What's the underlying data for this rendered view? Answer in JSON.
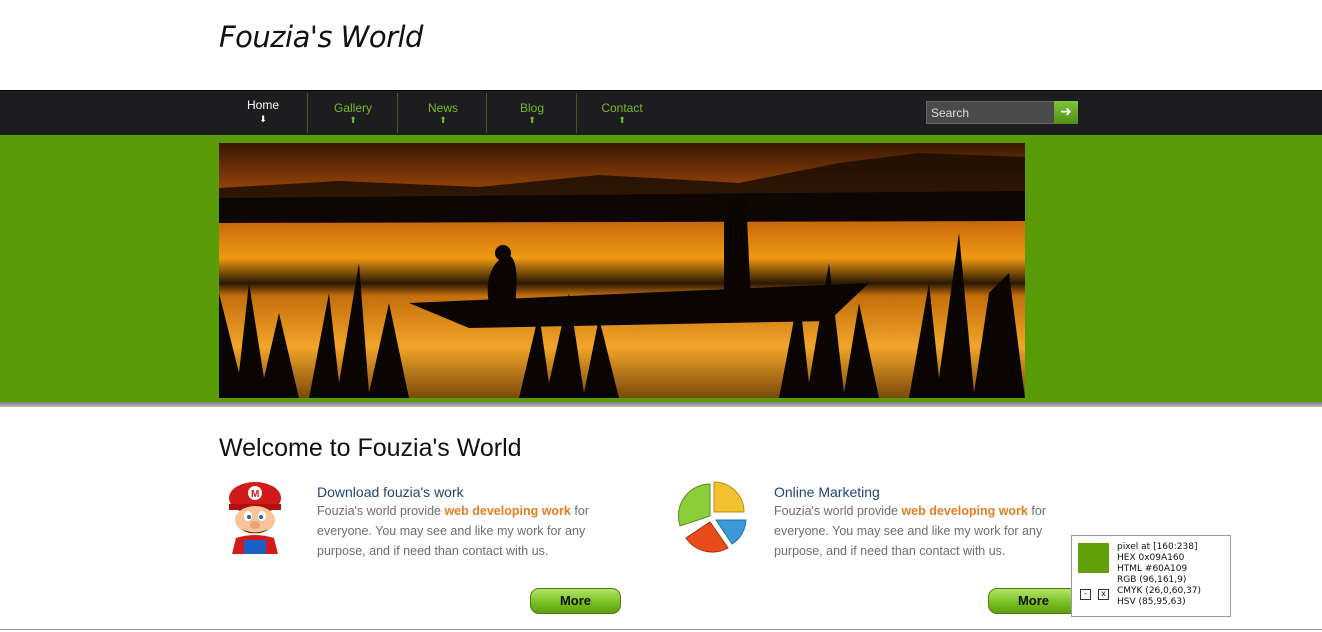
{
  "site": {
    "title": "Fouzia's World"
  },
  "nav": {
    "items": [
      {
        "label": "Home",
        "active": true
      },
      {
        "label": "Gallery",
        "active": false
      },
      {
        "label": "News",
        "active": false
      },
      {
        "label": "Blog",
        "active": false
      },
      {
        "label": "Contact",
        "active": false
      }
    ],
    "search_placeholder": "Search",
    "search_icon": "arrow-right-icon"
  },
  "hero": {
    "icon": "sunset-boat-photo"
  },
  "main": {
    "welcome": "Welcome to Fouzia's World",
    "features": [
      {
        "title": "Download fouzia's work",
        "text_before": "Fouzia's world provide ",
        "highlight": "web developing work",
        "text_after": " for everyone. You may see and like my work for any purpose, and if need than contact with us.",
        "button": "More",
        "icon": "mario-icon"
      },
      {
        "title": "Online Marketing",
        "text_before": "Fouzia's world provide ",
        "highlight": "web developing work",
        "text_after": " for everyone. You may see and like my work for any purpose, and if need than contact with us.",
        "button": "More",
        "icon": "pie-chart-icon"
      }
    ]
  },
  "picker": {
    "lines": [
      "pixel at [160:238]",
      "HEX 0x09A160",
      "HTML #60A109",
      "RGB (96,161,9)",
      "CMYK (26,0,60,37)",
      "HSV (85,95,63)"
    ],
    "minimize": "-",
    "close": "x",
    "swatch_color": "#60A109"
  },
  "colors": {
    "accent": "#5a9b0a",
    "nav_bg": "#1d1d1f",
    "nav_link": "#78b82a",
    "highlight": "#e67e22"
  }
}
